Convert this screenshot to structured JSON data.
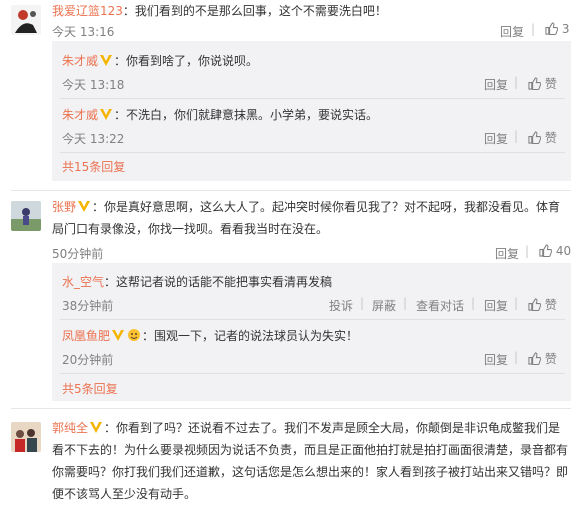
{
  "colors": {
    "name": "#eb7350",
    "text": "#333333",
    "muted": "#808080",
    "reply_bg": "#f2f2f5",
    "badge": "#f5b400"
  },
  "c1": {
    "user": "我爱辽篮123",
    "text": "：我们看到的不是那么回事，这个不需要洗白吧！",
    "time": "今天 13:16",
    "reply": "回复",
    "likes": "3",
    "subs": [
      {
        "user": "朱才威",
        "text": "：你看到啥了，你说说呗。",
        "time": "今天 13:18",
        "reply": "回复",
        "like": "赞"
      },
      {
        "user": "朱才威",
        "text": "：不洗白，你们就肆意抹黑。小学弟，要说实话。",
        "time": "今天 13:22",
        "reply": "回复",
        "like": "赞"
      }
    ],
    "more": "共15条回复"
  },
  "c2": {
    "user": "张野",
    "text_line1": "：你是真好意思啊，这么大人了。起冲突时候你看见我了？对不起呀，我都没看见。体育",
    "text_line2": "局门口有录像没，你找一找呗。看看我当时在没在。",
    "time": "50分钟前",
    "reply": "回复",
    "likes": "40",
    "subs": [
      {
        "user": "水_空气",
        "text": "：这帮记者说的话能不能把事实看清再发稿",
        "time": "38分钟前",
        "actions": [
          "投诉",
          "屏蔽",
          "查看对话",
          "回复"
        ],
        "like": "赞"
      },
      {
        "user": "凤凰鱼肥",
        "text": "：围观一下，记者的说法球员认为失实！",
        "time": "20分钟前",
        "reply": "回复",
        "like": "赞"
      }
    ],
    "more": "共5条回复"
  },
  "c3": {
    "user": "郭纯全",
    "text_line1": "：你看到了吗？还说看不过去了。我们不发声是顾全大局，你颠倒是非识龟成鳖我们是",
    "text_line2": "看不下去的！为什么要录视频因为说话不负责，而且是正面他拍打就是拍打画面很清楚，录音都有",
    "text_line3": "你需要吗？你打我们我们还道歉，这句话您是怎么想出来的！家人看到孩子被打站出来又错吗？即",
    "text_line4": "便不该骂人至少没有动手。"
  }
}
